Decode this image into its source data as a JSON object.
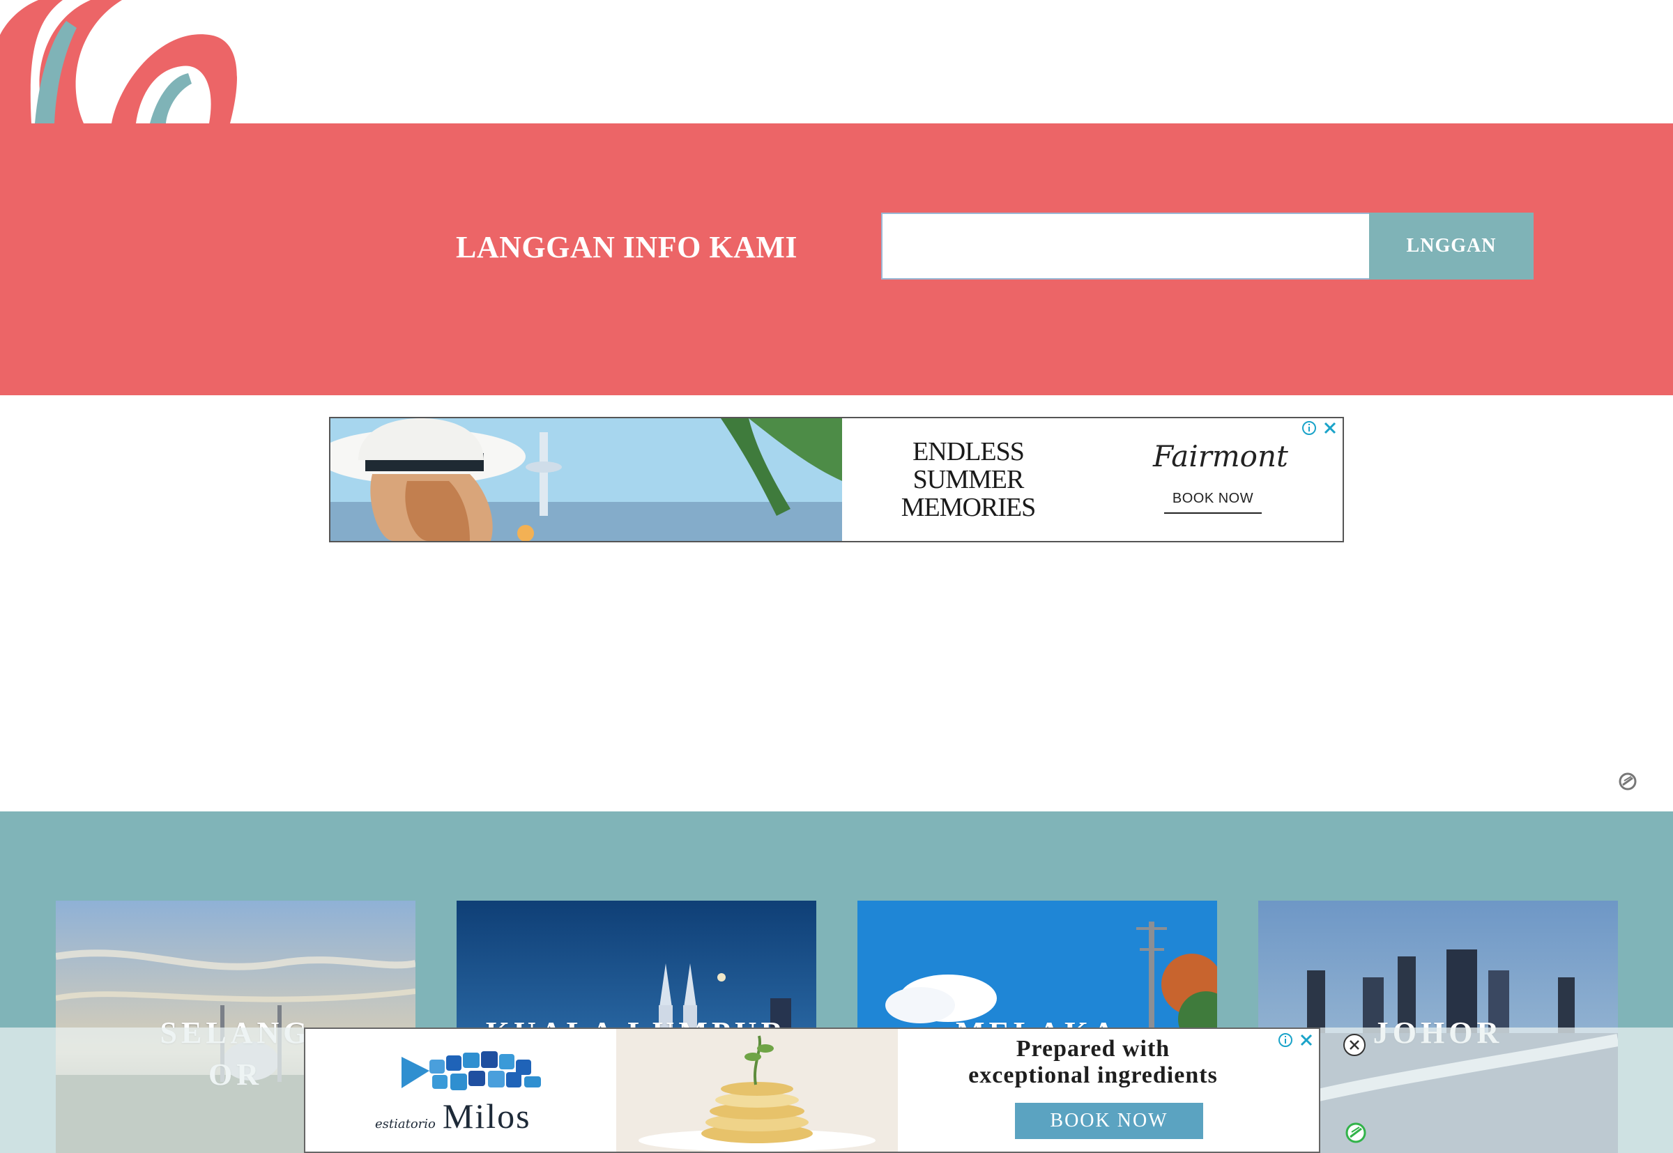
{
  "subscribe": {
    "title": "LANGGAN INFO KAMI",
    "input_placeholder": "",
    "input_value": "",
    "button_label": "LNGGAN"
  },
  "ad_top": {
    "headline": "ENDLESS SUMMER MEMORIES",
    "headline_lines": [
      "ENDLESS",
      "SUMMER",
      "MEMORIES"
    ],
    "brand": "Fairmont",
    "cta": "BOOK NOW"
  },
  "states": [
    {
      "name_lines": [
        "SELANG",
        "OR"
      ]
    },
    {
      "name_lines": [
        "KUALA LUMPUR"
      ]
    },
    {
      "name_lines": [
        "MELAKA"
      ]
    },
    {
      "name_lines": [
        "JOHOR"
      ]
    }
  ],
  "ad_bottom": {
    "logo_small": "estiatorio",
    "logo_big": "Milos",
    "headline_lines": [
      "Prepared with",
      "exceptional ingredients"
    ],
    "cta": "BOOK NOW"
  },
  "colors": {
    "coral": "#EC6567",
    "teal": "#80B4B8",
    "button_teal": "#7FB3B7",
    "ad_cta_blue": "#5BA3C1"
  },
  "icons": [
    "logo-brush",
    "adchoices-icon",
    "close-icon",
    "blocker-icon",
    "close-circle-icon"
  ]
}
